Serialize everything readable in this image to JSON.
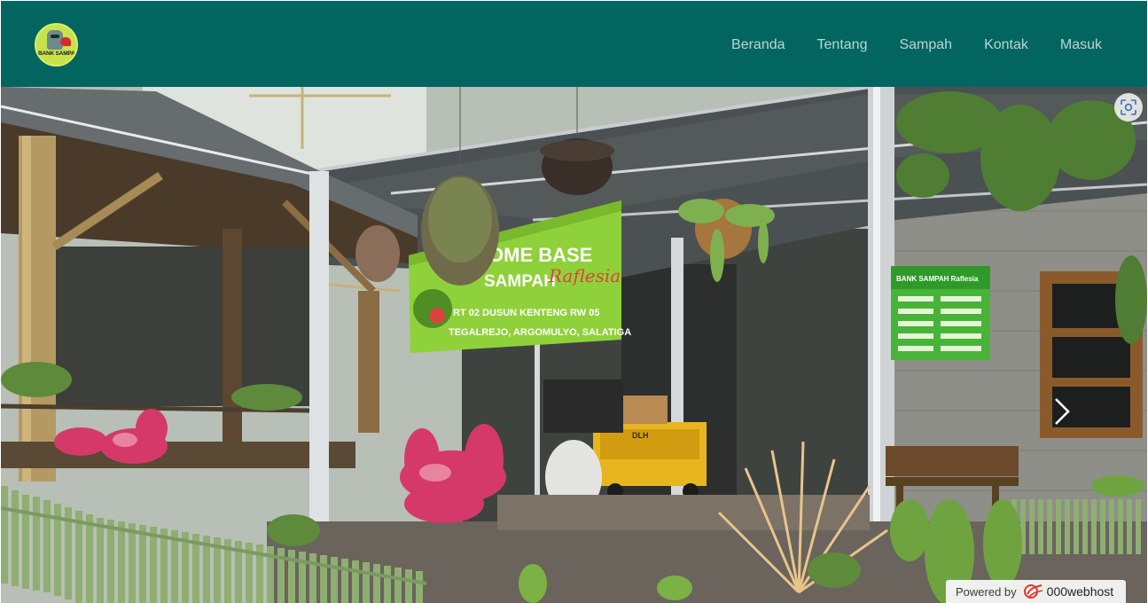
{
  "brand": {
    "logo_text": "BANK SAMPAH"
  },
  "nav": {
    "items": [
      {
        "label": "Beranda"
      },
      {
        "label": "Tentang"
      },
      {
        "label": "Sampah"
      },
      {
        "label": "Kontak"
      },
      {
        "label": "Masuk"
      }
    ]
  },
  "hero": {
    "banner_line1": "OME BASE",
    "banner_line2": "SAMPAH",
    "banner_script": "Raflesia",
    "banner_line3": "RT 02 DUSUN KENTENG RW 05",
    "banner_line4": "TEGALREJO, ARGOMULYO, SALATIGA",
    "wall_sign_title": "BANK SAMPAH Raflesia",
    "cart_label": "DLH"
  },
  "footer_badge": {
    "powered_label": "Powered by",
    "host_name": "000webhost"
  },
  "colors": {
    "navbar": "#026560",
    "nav_link": "#b9d6d4",
    "banner": "#8fd13a"
  },
  "icons": {
    "scan": "scan-icon",
    "next": "chevron-right-icon",
    "host": "000webhost-logo-icon"
  }
}
